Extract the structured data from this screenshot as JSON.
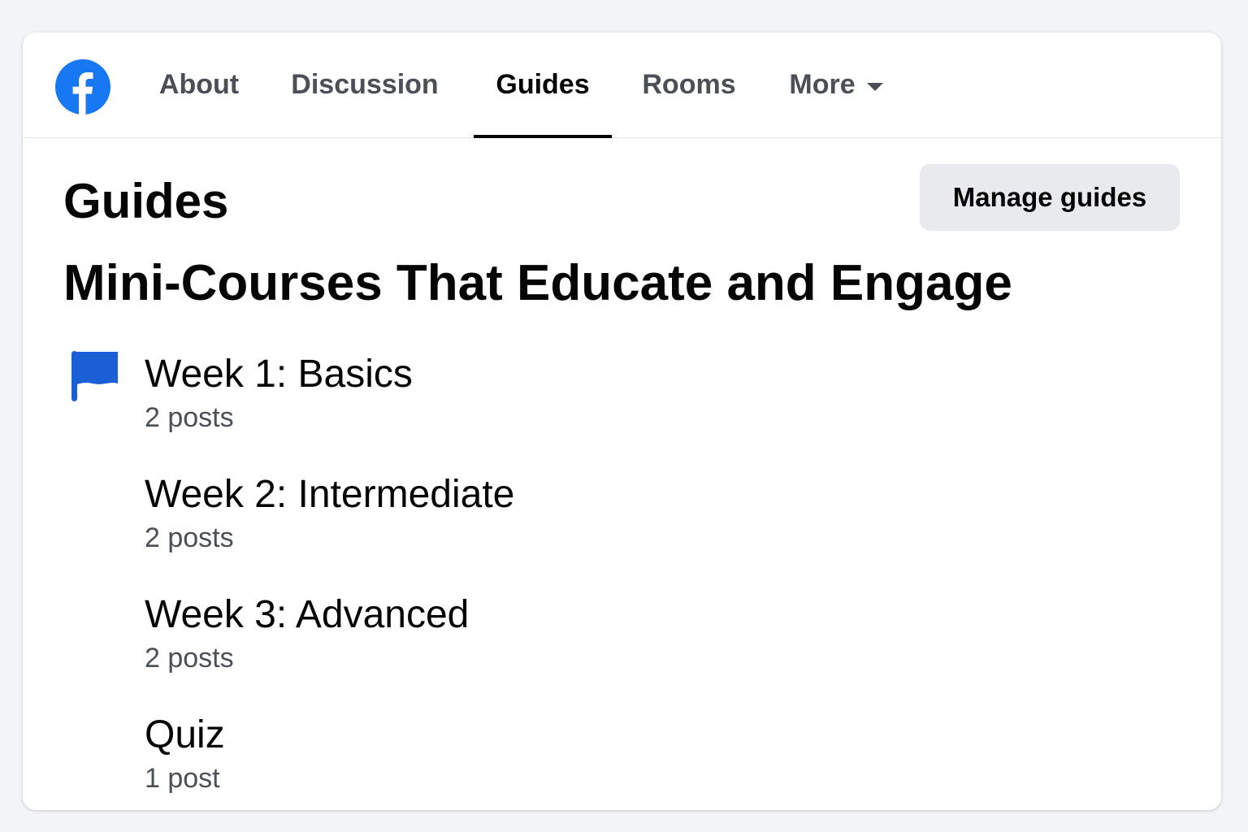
{
  "colors": {
    "brand_blue": "#1877f2",
    "flag_blue": "#1a5fd6",
    "page_background": "#f3f4f8",
    "button_background": "#e9eaee"
  },
  "nav": {
    "logo_icon": "facebook-logo-icon",
    "tabs": [
      {
        "label": "About"
      },
      {
        "label": "Discussion"
      },
      {
        "label": "Guides",
        "active": true
      },
      {
        "label": "Rooms"
      },
      {
        "label": "More",
        "icon": "chevron-down-icon"
      }
    ]
  },
  "guides": {
    "section_title": "Guides",
    "manage_label": "Manage guides",
    "collection_title": "Mini-Courses That Educate and Engage",
    "collection_icon": "flag-icon",
    "items": [
      {
        "title": "Week 1: Basics",
        "count": "2 posts"
      },
      {
        "title": "Week 2: Intermediate",
        "count": "2 posts"
      },
      {
        "title": "Week 3: Advanced",
        "count": "2 posts"
      },
      {
        "title": "Quiz",
        "count": "1 post"
      }
    ]
  }
}
